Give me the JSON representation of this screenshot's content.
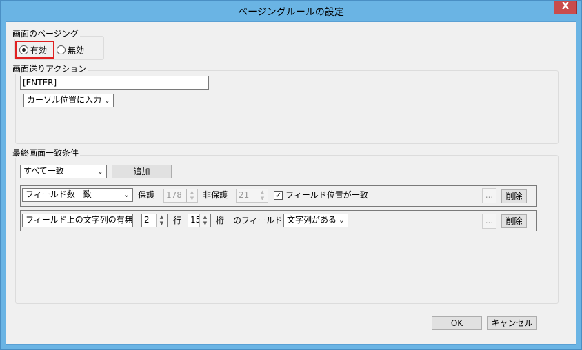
{
  "window": {
    "title": "ページングルールの設定",
    "close_label": "X"
  },
  "paging_group": {
    "label": "画面のページング",
    "enabled_label": "有効",
    "disabled_label": "無効",
    "selected": "有効"
  },
  "send_group": {
    "label": "画面送りアクション",
    "key_value": "[ENTER]",
    "position_option": "カーソル位置に入力"
  },
  "condition_group": {
    "label": "最終画面一致条件",
    "match_option": "すべて一致",
    "add_label": "追加",
    "rows": [
      {
        "type": "フィールド数一致",
        "protected_label": "保護",
        "protected_value": "178",
        "unprotected_label": "非保護",
        "unprotected_value": "21",
        "checkbox_label": "フィールド位置が一致",
        "checkbox_checked": true,
        "ellipsis_label": "...",
        "delete_label": "削除"
      },
      {
        "type": "フィールド上の文字列の有無",
        "row_value": "2",
        "row_label": "行",
        "col_value": "15",
        "col_label": "桁",
        "field_label": "のフィールドに",
        "string_option": "文字列がある",
        "ellipsis_label": "...",
        "delete_label": "削除"
      }
    ]
  },
  "footer": {
    "ok_label": "OK",
    "cancel_label": "キャンセル"
  }
}
